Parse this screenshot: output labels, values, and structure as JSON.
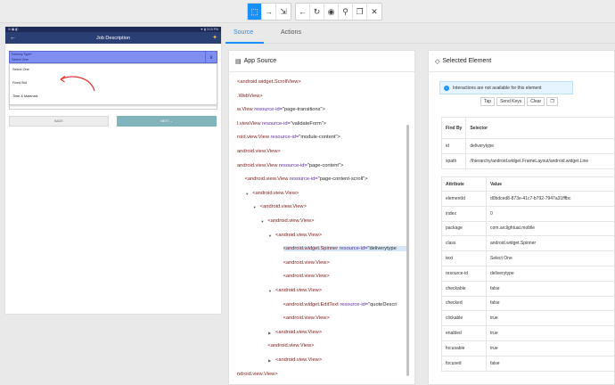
{
  "toolbar": {
    "buttons": [
      {
        "name": "select-icon",
        "glyph": "⬚"
      },
      {
        "name": "swipe-icon",
        "glyph": "→"
      },
      {
        "name": "tap-coordinates-icon",
        "glyph": "⇲"
      },
      {
        "name": "back-icon",
        "glyph": "←"
      },
      {
        "name": "refresh-icon",
        "glyph": "↻"
      },
      {
        "name": "eye-icon",
        "glyph": "◉"
      },
      {
        "name": "search-icon",
        "glyph": "⚲"
      },
      {
        "name": "copy-icon",
        "glyph": "❐"
      },
      {
        "name": "close-icon",
        "glyph": "✕"
      }
    ]
  },
  "device": {
    "status_left": "✉ ▣ ◧",
    "status_right": "▼ ▮ 3:15 PM",
    "appbar": {
      "back": "←",
      "title": "Job Description"
    },
    "spinner": {
      "label": "Delivery Type*",
      "value": "Select One",
      "arrow": "∨"
    },
    "options": [
      "Select One",
      "Fixed Bid",
      "Time & Materials"
    ],
    "back_button": "BACK",
    "next_button": "NEXT →"
  },
  "tabs": {
    "source": "Source",
    "actions": "Actions"
  },
  "source_panel": {
    "title": "App Source",
    "nodes": [
      {
        "indent": 0,
        "tag": "<android.widget.ScrollView>",
        "attr": "",
        "val": "",
        "toggle": ""
      },
      {
        "indent": 0,
        "tag": ".WebView>",
        "attr": "",
        "val": "",
        "toggle": ""
      },
      {
        "indent": 0,
        "tag": "w.View",
        "attr": " resource-id=",
        "val": "\"page-transitions\">",
        "toggle": ""
      },
      {
        "indent": 0,
        "tag": "l.viewView",
        "attr": " resource-id=",
        "val": "\"validateForm\">",
        "toggle": ""
      },
      {
        "indent": 0,
        "tag": "roid.view.View",
        "attr": " resource-id=",
        "val": "\"module-content\">",
        "toggle": ""
      },
      {
        "indent": 0,
        "tag": "android.view.View>",
        "attr": "",
        "val": "",
        "toggle": ""
      },
      {
        "indent": 0,
        "tag": "android.view.View",
        "attr": " resource-id=",
        "val": "\"page-content\">",
        "toggle": ""
      },
      {
        "indent": 1,
        "tag": "<android.view.View",
        "attr": " resource-id=",
        "val": "\"page-content-scroll\">",
        "toggle": ""
      },
      {
        "indent": 2,
        "tag": "<android.view.View>",
        "attr": "",
        "val": "",
        "toggle": "▼"
      },
      {
        "indent": 3,
        "tag": "<android.view.View>",
        "attr": "",
        "val": "",
        "toggle": "▼"
      },
      {
        "indent": 4,
        "tag": "<android.view.View>",
        "attr": "",
        "val": "",
        "toggle": "▼"
      },
      {
        "indent": 5,
        "tag": "<android.view.View>",
        "attr": "",
        "val": "",
        "toggle": "▼"
      },
      {
        "indent": 6,
        "tag": "<android.widget.Spinner",
        "attr": " resource-id=",
        "val": "\"deliverytype",
        "toggle": "",
        "selected": true
      },
      {
        "indent": 6,
        "tag": "<android.view.View>",
        "attr": "",
        "val": "",
        "toggle": ""
      },
      {
        "indent": 6,
        "tag": "<android.view.View>",
        "attr": "",
        "val": "",
        "toggle": ""
      },
      {
        "indent": 5,
        "tag": "<android.view.View>",
        "attr": "",
        "val": "",
        "toggle": "▼"
      },
      {
        "indent": 6,
        "tag": "<android.widget.EditText",
        "attr": " resource-id=",
        "val": "\"quoteDescri",
        "toggle": ""
      },
      {
        "indent": 6,
        "tag": "<android.view.View>",
        "attr": "",
        "val": "",
        "toggle": ""
      },
      {
        "indent": 5,
        "tag": "<android.view.View>",
        "attr": "",
        "val": "",
        "toggle": "▶"
      },
      {
        "indent": 4,
        "tag": "<android.view.View>",
        "attr": "",
        "val": "",
        "toggle": ""
      },
      {
        "indent": 5,
        "tag": "<android.view.View>",
        "attr": "",
        "val": "",
        "toggle": "▶"
      },
      {
        "indent": 0,
        "tag": "ndroid.view.View>",
        "attr": "",
        "val": "",
        "toggle": ""
      }
    ]
  },
  "selected_panel": {
    "title": "Selected Element",
    "info": "Interactions are not available for this element",
    "buttons": [
      "Tap",
      "Send Keys",
      "Clear"
    ],
    "find_headers": [
      "Find By",
      "Selector"
    ],
    "find_rows": [
      [
        "id",
        "deliverytype"
      ],
      [
        "xpath",
        "//hierarchy/android.widget.FrameLayout/android.widget.Line"
      ]
    ],
    "attr_headers": [
      "Attribute",
      "Value"
    ],
    "attr_rows": [
      [
        "elementId",
        "d0bdced8-873e-41c7-b792-7947a31fffbc"
      ],
      [
        "index",
        "0"
      ],
      [
        "package",
        "com.arclightuat.mobile"
      ],
      [
        "class",
        "android.widget.Spinner"
      ],
      [
        "text",
        "Select One"
      ],
      [
        "resource-id",
        "deliverytype"
      ],
      [
        "checkable",
        "false"
      ],
      [
        "checked",
        "false"
      ],
      [
        "clickable",
        "true"
      ],
      [
        "enabled",
        "true"
      ],
      [
        "focusable",
        "true"
      ],
      [
        "focused",
        "false"
      ]
    ]
  }
}
